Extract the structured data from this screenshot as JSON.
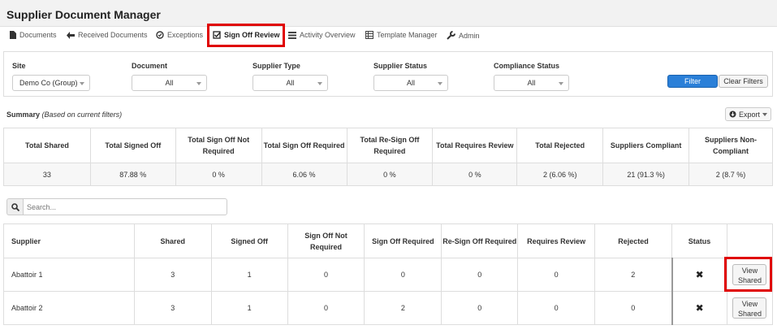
{
  "app": {
    "title": "Supplier Document Manager"
  },
  "nav": {
    "documents": "Documents",
    "received": "Received Documents",
    "exceptions": "Exceptions",
    "signoff": "Sign Off Review",
    "activity": "Activity Overview",
    "template": "Template Manager",
    "admin": "Admin"
  },
  "filters": {
    "site_label": "Site",
    "site_value": "Demo Co (Group)",
    "document_label": "Document",
    "document_value": "All",
    "supplier_type_label": "Supplier Type",
    "supplier_type_value": "All",
    "supplier_status_label": "Supplier Status",
    "supplier_status_value": "All",
    "compliance_label": "Compliance Status",
    "compliance_value": "All",
    "filter_button": "Filter",
    "clear_button": "Clear Filters"
  },
  "summary": {
    "title": "Summary",
    "subtitle": "(Based on current filters)",
    "export": "Export",
    "headers": [
      "Total Shared",
      "Total Signed Off",
      "Total Sign Off Not Required",
      "Total Sign Off Required",
      "Total Re-Sign Off Required",
      "Total Requires Review",
      "Total Rejected",
      "Suppliers Compliant",
      "Suppliers Non-Compliant"
    ],
    "values": [
      "33",
      "87.88 %",
      "0 %",
      "6.06 %",
      "0 %",
      "0 %",
      "2 (6.06 %)",
      "21 (91.3 %)",
      "2 (8.7 %)"
    ]
  },
  "search": {
    "placeholder": "Search..."
  },
  "table": {
    "headers": [
      "Supplier",
      "Shared",
      "Signed Off",
      "Sign Off Not Required",
      "Sign Off Required",
      "Re-Sign Off Required",
      "Requires Review",
      "Rejected",
      "Status"
    ],
    "view_label": "View Shared",
    "rows": [
      {
        "supplier": "Abattoir 1",
        "shared": "3",
        "signed_off": "1",
        "not_required": "0",
        "required": "0",
        "resign": "0",
        "review": "0",
        "rejected": "2",
        "status": "✖"
      },
      {
        "supplier": "Abattoir 2",
        "shared": "3",
        "signed_off": "1",
        "not_required": "0",
        "required": "2",
        "resign": "0",
        "review": "0",
        "rejected": "0",
        "status": "✖"
      }
    ]
  },
  "colors": {
    "highlight": "#e00000",
    "primary_button": "#2a7fd8"
  }
}
